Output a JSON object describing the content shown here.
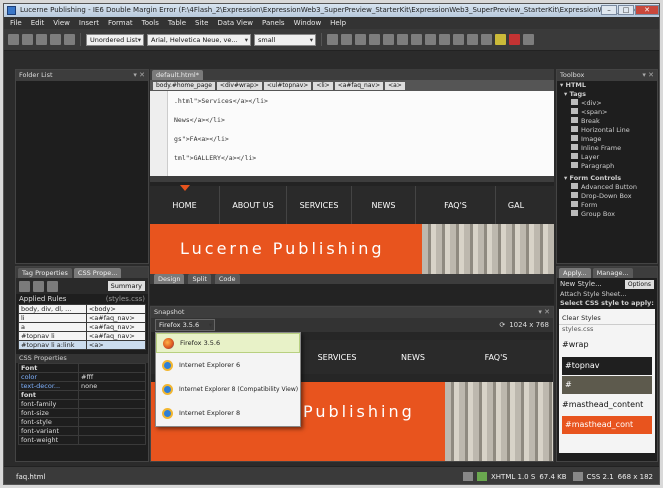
{
  "window": {
    "title": "Lucerne Publishing - IE6 Double Margin Error (F:\\4Flash_2\\Expression\\ExpressionWeb3_SuperPreview_StarterKit\\ExpressionWeb3_SuperPreview_StarterKit\\ExpressionWeb3_SuperPreview..."
  },
  "menu": [
    "File",
    "Edit",
    "View",
    "Insert",
    "Format",
    "Tools",
    "Table",
    "Site",
    "Data View",
    "Panels",
    "Window",
    "Help"
  ],
  "toolbar": {
    "style_select": "Unordered List",
    "font_select": "Arial, Helvetica Neue, ve...",
    "size_select": "small"
  },
  "folder_list": {
    "title": "Folder List"
  },
  "editor": {
    "tab": "default.html*",
    "breadcrumb": [
      "body.#home_page",
      "<div#wrap>",
      "<ul#topnav>",
      "<li>",
      "<a#faq_nav>",
      "<a>"
    ],
    "code_lines": [
      ".html\">Services</a></li>",
      "News</a></li>",
      "gs\">FA<a></li>",
      "tml\">GALLERY</a></li>"
    ],
    "nav": [
      "HOME",
      "ABOUT US",
      "SERVICES",
      "NEWS",
      "FAQ'S",
      "GAL"
    ],
    "banner": "Lucerne Publishing",
    "view_tabs": [
      "Design",
      "Split",
      "Code"
    ]
  },
  "tag_properties": {
    "tabs": [
      "Tag Properties",
      "CSS Prope..."
    ],
    "summary_btn": "Summary",
    "applied_rules_label": "Applied Rules",
    "applied_rules_source": "(styles.css)",
    "rules": [
      [
        "body, div, dl, ...",
        "<body>"
      ],
      [
        "li",
        "<a#faq_nav>"
      ],
      [
        "a",
        "<a#faq_nav>"
      ],
      [
        "#topnav li",
        "<a#faq_nav>"
      ],
      [
        "#topnav li a:link",
        "<a>"
      ]
    ],
    "css_props_label": "CSS Properties",
    "props": [
      [
        "Font",
        ""
      ],
      [
        "color",
        "#fff"
      ],
      [
        "text-decor...",
        "none"
      ],
      [
        "font",
        ""
      ],
      [
        "font-family",
        ""
      ],
      [
        "font-size",
        ""
      ],
      [
        "font-style",
        ""
      ],
      [
        "font-variant",
        ""
      ],
      [
        "font-weight",
        ""
      ]
    ]
  },
  "superpreview": {
    "title": "Snapshot",
    "browser_select": "Firefox 3.5.6",
    "browsers": [
      "Firefox 3.5.6",
      "Internet Explorer 6",
      "Internet Explorer 8 (Compatibility View)",
      "Internet Explorer 8"
    ],
    "size": "1024 x 768",
    "nav": [
      "SERVICES",
      "NEWS",
      "FAQ'S"
    ],
    "banner": "Publishing"
  },
  "toolbox": {
    "title": "Toolbox",
    "sections": [
      {
        "label": "HTML",
        "items": []
      },
      {
        "label": "Tags",
        "items": [
          "<div>",
          "<span>",
          "Break",
          "Horizontal Line",
          "Image",
          "Inline Frame",
          "Layer",
          "Paragraph"
        ]
      },
      {
        "label": "Form Controls",
        "items": [
          "Advanced Button",
          "Drop-Down Box",
          "Form",
          "Group Box"
        ]
      }
    ]
  },
  "apply_styles": {
    "tabs": [
      "Apply...",
      "Manage..."
    ],
    "new_style": "New Style...",
    "options": "Options",
    "attach": "Attach Style Sheet...",
    "select_label": "Select CSS style to apply:",
    "clear": "Clear Styles",
    "sheet": "styles.css",
    "styles": [
      "#wrap",
      "#topnav",
      "#",
      "#masthead_content",
      "#masthead_cont"
    ]
  },
  "statusbar": {
    "file": "faq.html",
    "doctype": "XHTML 1.0 S",
    "size": "67.4 KB",
    "css": "CSS 2.1",
    "dims": "668 x 182"
  }
}
